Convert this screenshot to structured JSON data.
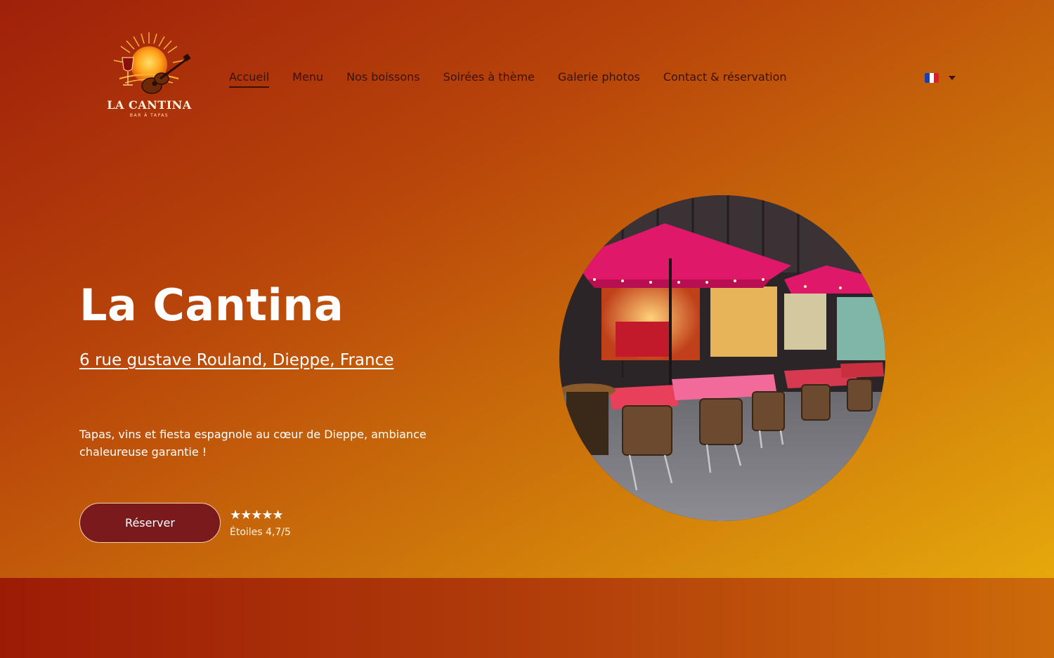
{
  "brand": {
    "name": "La Cantina",
    "logo_name": "LA CANTINA",
    "logo_sub": "BAR À TAPAS",
    "logo_icons": [
      "sun-icon",
      "wine-glass-icon",
      "guitar-icon"
    ]
  },
  "nav": {
    "items": [
      {
        "label": "Accueil",
        "active": true
      },
      {
        "label": "Menu"
      },
      {
        "label": "Nos boissons"
      },
      {
        "label": "Soirées à thème"
      },
      {
        "label": "Galerie photos"
      },
      {
        "label": "Contact & réservation"
      }
    ],
    "language": {
      "flag": "france-flag-icon",
      "dropdown": "caret-down-icon"
    }
  },
  "hero": {
    "title": "La Cantina",
    "address": "6 rue gustave Rouland, Dieppe, France",
    "tagline": "Tapas, vins et fiesta espagnole au cœur de Dieppe, ambiance chaleureuse garantie !",
    "cta_label": "Réserver",
    "rating": {
      "stars": "★★★★★",
      "value": 4.7,
      "label": "Étoiles 4,7/5"
    },
    "photo": "restaurant-terrace-photo"
  },
  "colors": {
    "gradient_start": "#a0200a",
    "gradient_end": "#e6a80c",
    "button_bg": "#7a1a1c",
    "nav_text": "#3a1208",
    "accent_umbrella": "#e0186a"
  }
}
